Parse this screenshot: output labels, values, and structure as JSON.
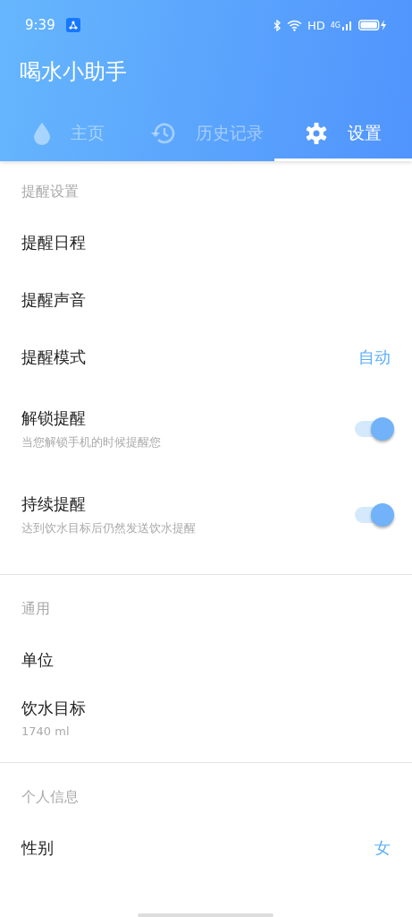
{
  "status_bar": {
    "time": "9:39",
    "hd": "HD",
    "network": "4G"
  },
  "app_title": "喝水小助手",
  "tabs": [
    {
      "label": "主页",
      "kind": "drop",
      "selected": false
    },
    {
      "label": "历史记录",
      "kind": "history",
      "selected": false
    },
    {
      "label": "设置",
      "kind": "gear",
      "selected": true
    }
  ],
  "sections": [
    {
      "title": "提醒设置",
      "items": [
        {
          "kind": "plain",
          "label": "提醒日程"
        },
        {
          "kind": "plain",
          "label": "提醒声音"
        },
        {
          "kind": "value",
          "label": "提醒模式",
          "value": "自动"
        },
        {
          "kind": "toggle",
          "label": "解锁提醒",
          "subtitle": "当您解锁手机的时候提醒您",
          "on": true
        },
        {
          "kind": "toggle",
          "label": "持续提醒",
          "subtitle": "达到饮水目标后仍然发送饮水提醒",
          "on": true
        }
      ]
    },
    {
      "title": "通用",
      "items": [
        {
          "kind": "plain",
          "label": "单位"
        },
        {
          "kind": "plain",
          "label": "饮水目标",
          "subtitle": "1740 ml"
        }
      ]
    },
    {
      "title": "个人信息",
      "items": [
        {
          "kind": "value",
          "label": "性别",
          "value": "女"
        }
      ]
    }
  ]
}
